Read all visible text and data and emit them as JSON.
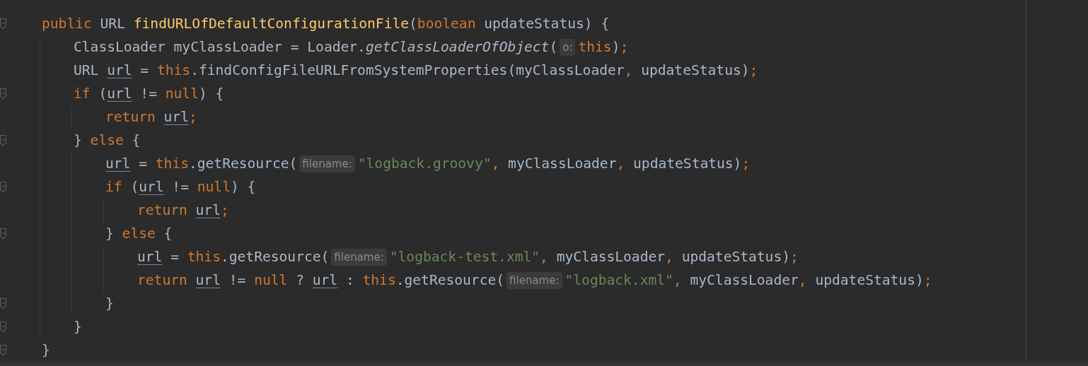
{
  "editor": {
    "lines": [
      {
        "fold": true,
        "tokens": [
          {
            "kind": "kw",
            "t": "public"
          },
          {
            "kind": "p",
            "t": " URL "
          },
          {
            "kind": "decl",
            "t": "findURLOfDefaultConfigurationFile"
          },
          {
            "kind": "p",
            "t": "("
          },
          {
            "kind": "kw",
            "t": "boolean"
          },
          {
            "kind": "p",
            "t": " updateStatus) {"
          }
        ],
        "children": [
          {
            "fold": false,
            "tokens": [
              {
                "kind": "p",
                "t": "ClassLoader myClassLoader = Loader."
              },
              {
                "kind": "it",
                "t": "getClassLoaderOfObject"
              },
              {
                "kind": "p",
                "t": "("
              },
              {
                "kind": "hint",
                "t": "o:"
              },
              {
                "kind": "kw",
                "t": "this"
              },
              {
                "kind": "p",
                "t": ")"
              },
              {
                "kind": "pu",
                "t": ";"
              }
            ]
          },
          {
            "fold": false,
            "tokens": [
              {
                "kind": "p",
                "t": "URL "
              },
              {
                "kind": "var",
                "t": "url"
              },
              {
                "kind": "p",
                "t": " = "
              },
              {
                "kind": "kw",
                "t": "this"
              },
              {
                "kind": "p",
                "t": ".findConfigFileURLFromSystemProperties(myClassLoader"
              },
              {
                "kind": "pu",
                "t": ","
              },
              {
                "kind": "p",
                "t": " updateStatus)"
              },
              {
                "kind": "pu",
                "t": ";"
              }
            ]
          },
          {
            "fold": true,
            "tokens": [
              {
                "kind": "kw",
                "t": "if"
              },
              {
                "kind": "p",
                "t": " ("
              },
              {
                "kind": "var",
                "t": "url"
              },
              {
                "kind": "p",
                "t": " != "
              },
              {
                "kind": "kw",
                "t": "null"
              },
              {
                "kind": "p",
                "t": ") {"
              }
            ],
            "children": [
              {
                "fold": false,
                "tokens": [
                  {
                    "kind": "kw",
                    "t": "return "
                  },
                  {
                    "kind": "var",
                    "t": "url"
                  },
                  {
                    "kind": "pu",
                    "t": ";"
                  }
                ]
              }
            ]
          },
          {
            "fold": true,
            "tokens": [
              {
                "kind": "p",
                "t": "} "
              },
              {
                "kind": "kw",
                "t": "else"
              },
              {
                "kind": "p",
                "t": " {"
              }
            ],
            "children": [
              {
                "fold": false,
                "tokens": [
                  {
                    "kind": "var",
                    "t": "url"
                  },
                  {
                    "kind": "p",
                    "t": " = "
                  },
                  {
                    "kind": "kw",
                    "t": "this"
                  },
                  {
                    "kind": "p",
                    "t": ".getResource("
                  },
                  {
                    "kind": "hint",
                    "t": "filename:"
                  },
                  {
                    "kind": "str",
                    "t": "\"logback.groovy\""
                  },
                  {
                    "kind": "pu",
                    "t": ","
                  },
                  {
                    "kind": "p",
                    "t": " myClassLoader"
                  },
                  {
                    "kind": "pu",
                    "t": ","
                  },
                  {
                    "kind": "p",
                    "t": " updateStatus)"
                  },
                  {
                    "kind": "pu",
                    "t": ";"
                  }
                ]
              },
              {
                "fold": true,
                "tokens": [
                  {
                    "kind": "kw",
                    "t": "if"
                  },
                  {
                    "kind": "p",
                    "t": " ("
                  },
                  {
                    "kind": "var",
                    "t": "url"
                  },
                  {
                    "kind": "p",
                    "t": " != "
                  },
                  {
                    "kind": "kw",
                    "t": "null"
                  },
                  {
                    "kind": "p",
                    "t": ") {"
                  }
                ],
                "children": [
                  {
                    "fold": false,
                    "tokens": [
                      {
                        "kind": "kw",
                        "t": "return "
                      },
                      {
                        "kind": "var",
                        "t": "url"
                      },
                      {
                        "kind": "pu",
                        "t": ";"
                      }
                    ]
                  }
                ]
              },
              {
                "fold": true,
                "tokens": [
                  {
                    "kind": "p",
                    "t": "} "
                  },
                  {
                    "kind": "kw",
                    "t": "else"
                  },
                  {
                    "kind": "p",
                    "t": " {"
                  }
                ],
                "children": [
                  {
                    "fold": false,
                    "tokens": [
                      {
                        "kind": "var",
                        "t": "url"
                      },
                      {
                        "kind": "p",
                        "t": " = "
                      },
                      {
                        "kind": "kw",
                        "t": "this"
                      },
                      {
                        "kind": "p",
                        "t": ".getResource("
                      },
                      {
                        "kind": "hint",
                        "t": "filename:"
                      },
                      {
                        "kind": "str",
                        "t": "\"logback-test.xml\""
                      },
                      {
                        "kind": "pu",
                        "t": ","
                      },
                      {
                        "kind": "p",
                        "t": " myClassLoader"
                      },
                      {
                        "kind": "pu",
                        "t": ","
                      },
                      {
                        "kind": "p",
                        "t": " updateStatus)"
                      },
                      {
                        "kind": "pu",
                        "t": ";"
                      }
                    ]
                  },
                  {
                    "fold": false,
                    "tokens": [
                      {
                        "kind": "kw",
                        "t": "return "
                      },
                      {
                        "kind": "var",
                        "t": "url"
                      },
                      {
                        "kind": "p",
                        "t": " != "
                      },
                      {
                        "kind": "kw",
                        "t": "null"
                      },
                      {
                        "kind": "p",
                        "t": " ? "
                      },
                      {
                        "kind": "var",
                        "t": "url"
                      },
                      {
                        "kind": "p",
                        "t": " : "
                      },
                      {
                        "kind": "kw",
                        "t": "this"
                      },
                      {
                        "kind": "p",
                        "t": ".getResource("
                      },
                      {
                        "kind": "hint",
                        "t": "filename:"
                      },
                      {
                        "kind": "str",
                        "t": "\"logback.xml\""
                      },
                      {
                        "kind": "pu",
                        "t": ","
                      },
                      {
                        "kind": "p",
                        "t": " myClassLoader"
                      },
                      {
                        "kind": "pu",
                        "t": ","
                      },
                      {
                        "kind": "p",
                        "t": " updateStatus)"
                      },
                      {
                        "kind": "pu",
                        "t": ";"
                      }
                    ]
                  }
                ]
              },
              {
                "fold": true,
                "tokens": [
                  {
                    "kind": "p",
                    "t": "}"
                  }
                ]
              }
            ]
          },
          {
            "fold": true,
            "tokens": [
              {
                "kind": "p",
                "t": "}"
              }
            ]
          }
        ]
      },
      {
        "fold": true,
        "tokens": [
          {
            "kind": "p",
            "t": "}"
          }
        ]
      }
    ]
  }
}
